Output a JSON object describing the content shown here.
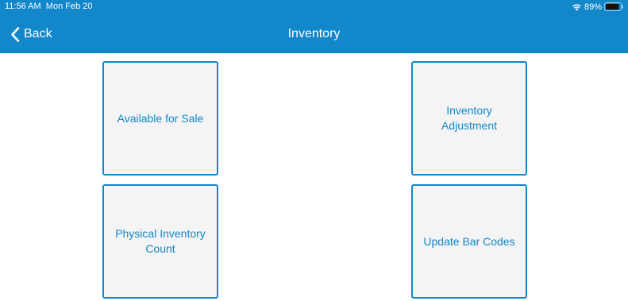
{
  "status_bar": {
    "time": "11:56 AM",
    "date": "Mon Feb 20",
    "battery": "89%",
    "wifi_icon": "wifi-icon",
    "battery_icon": "battery-icon"
  },
  "nav": {
    "back_label": "Back",
    "back_icon": "chevron-left-icon",
    "title": "Inventory"
  },
  "tiles": [
    {
      "label_lines": [
        "Available for Sale"
      ]
    },
    {
      "label_lines": [
        "Inventory",
        "Adjustment"
      ]
    },
    {
      "label_lines": [
        "Physical Inventory",
        "Count"
      ]
    },
    {
      "label_lines": [
        "Update Bar Codes"
      ]
    }
  ],
  "colors": {
    "accent": "#1287c9",
    "tile_background": "#f4f4f4",
    "header_text": "#ffffff"
  }
}
